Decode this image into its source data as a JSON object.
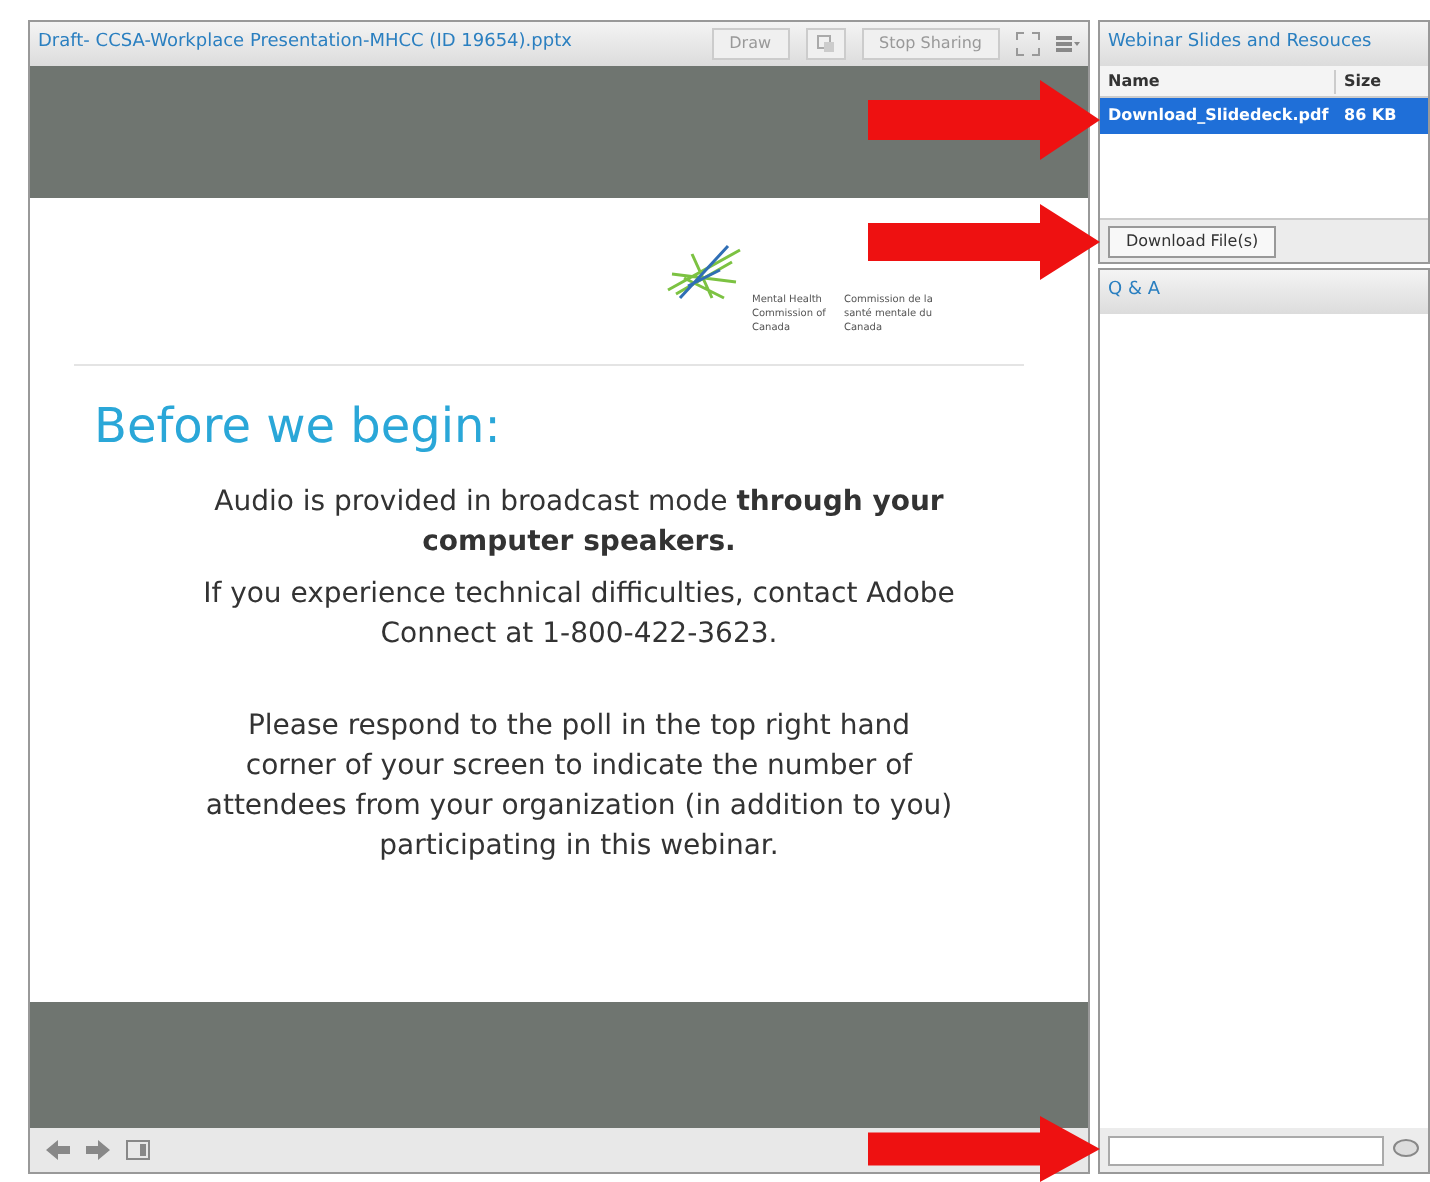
{
  "share_pod": {
    "title": "Draft- CCSA-Workplace Presentation-MHCC (ID 19654).pptx",
    "toolbar": [
      {
        "kind": "text",
        "label": "Draw"
      },
      {
        "kind": "icon"
      },
      {
        "kind": "text",
        "label": "Stop Sharing"
      },
      {
        "kind": "fullscreen"
      },
      {
        "kind": "menu"
      }
    ]
  },
  "slide": {
    "logo_en": "Mental Health Commission of Canada",
    "logo_fr": "Commission de la santé mentale du Canada",
    "title": "Before we begin:",
    "paragraphs": [
      "Audio is provided in broadcast mode **through your computer speakers.**",
      "If you experience technical difficulties, contact Adobe Connect at 1-800-422-3623.",
      "Please respond to the poll in the top right hand corner of your screen to indicate the number of attendees from your organization (in addition to you) participating in this webinar."
    ]
  },
  "files_pod": {
    "title": "Webinar Slides and Resouces",
    "columns": [
      "Name",
      "Size"
    ],
    "rows": [
      {
        "name": "Download_Slidedeck.pdf",
        "size": "86 KB",
        "selected": true
      }
    ],
    "button": "Download File(s)"
  },
  "qa_pod": {
    "title": "Q & A"
  }
}
